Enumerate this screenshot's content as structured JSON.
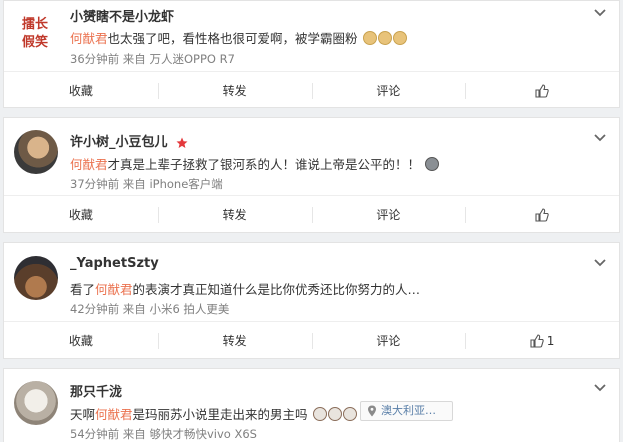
{
  "posts": [
    {
      "username": "小赟瞎不是小龙虾",
      "avatar_text": [
        "擂长",
        "假笑"
      ],
      "mention": "何猷君",
      "text": "也太强了吧，看性格也很可爱啊，被学霸圈粉",
      "time": "36分钟前",
      "source_prefix": "来自",
      "source": "万人迷OPPO R7",
      "actions": {
        "favorite": "收藏",
        "repost": "转发",
        "comment": "评论",
        "likes": ""
      }
    },
    {
      "username": "许小树_小豆包儿",
      "mention": "何猷君",
      "text": "才真是上辈子拯救了银河系的人！谁说上帝是公平的！！",
      "time": "37分钟前",
      "source_prefix": "来自",
      "source": "iPhone客户端",
      "actions": {
        "favorite": "收藏",
        "repost": "转发",
        "comment": "评论",
        "likes": ""
      }
    },
    {
      "username": "_YaphetSzty",
      "prefix": "看了",
      "mention": "何猷君",
      "text": "的表演才真正知道什么是比你优秀还比你努力的人…",
      "time": "42分钟前",
      "source_prefix": "来自",
      "source": "小米6 拍人更美",
      "actions": {
        "favorite": "收藏",
        "repost": "转发",
        "comment": "评论",
        "likes": "1"
      }
    },
    {
      "username": "那只千泷",
      "prefix": "天啊",
      "mention": "何猷君",
      "text": "是玛丽苏小说里走出来的男主吗",
      "location": "澳大利亚…",
      "time": "54分钟前",
      "source_prefix": "来自",
      "source": "够快才畅快vivo X6S"
    }
  ],
  "colors": {
    "mention": "#eb7350",
    "meta": "#808080",
    "badge": "#e4393c"
  },
  "icons": [
    "chevron-down-icon",
    "thumbs-up-icon",
    "location-pin-icon",
    "star-badge-icon",
    "alien-emoji-icon",
    "doge-emoji-icon",
    "face-emoji-icon"
  ]
}
